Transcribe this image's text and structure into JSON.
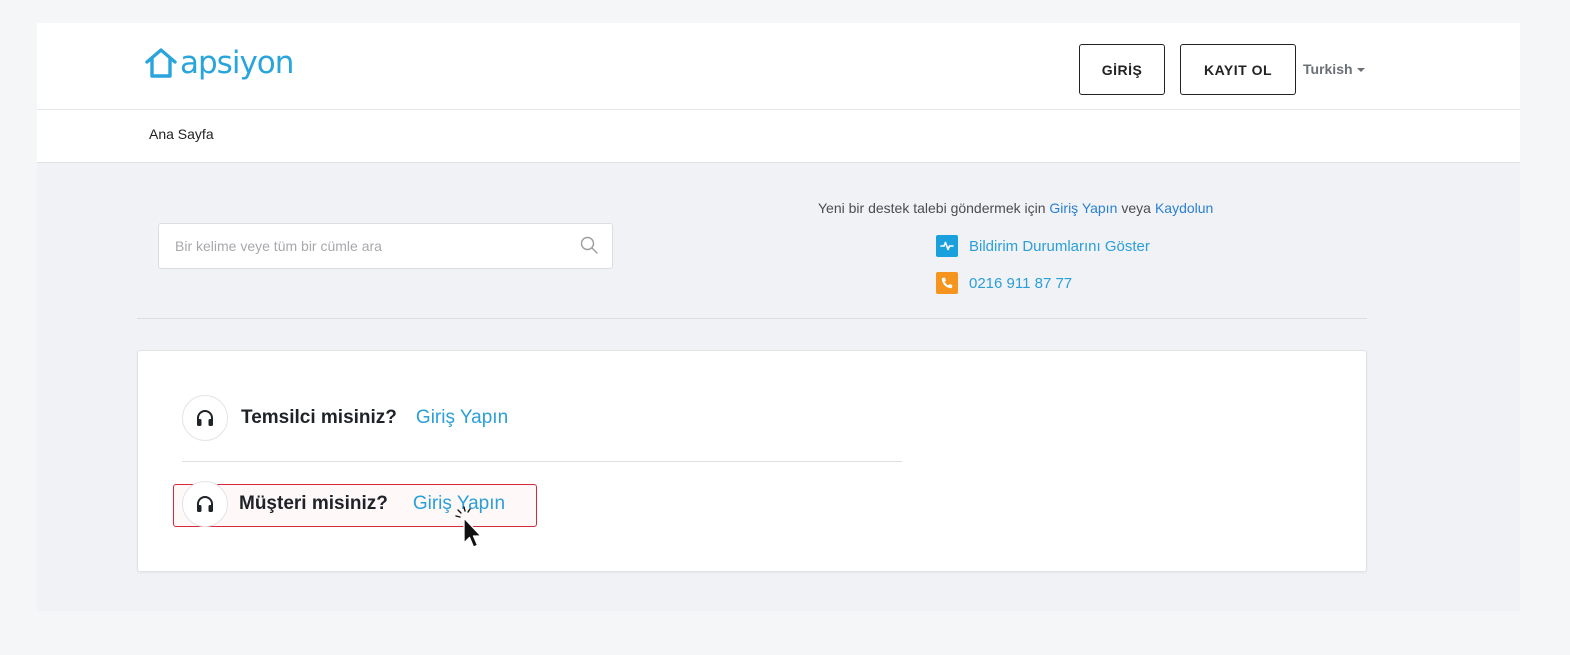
{
  "header": {
    "logo_text": "apsiyon",
    "login_label": "GİRİŞ",
    "register_label": "KAYIT OL",
    "language": "Turkish"
  },
  "breadcrumb": {
    "home": "Ana Sayfa"
  },
  "search": {
    "placeholder": "Bir kelime veye tüm bir cümle ara",
    "value": ""
  },
  "support": {
    "prefix": "Yeni bir destek talebi göndermek için",
    "login_link": "Giriş Yapın",
    "middle": "veya",
    "register_link": "Kaydolun",
    "status_link": "Bildirim Durumlarını Göster",
    "phone": "0216 911 87 77"
  },
  "login_options": [
    {
      "question": "Temsilci misiniz?",
      "link": "Giriş Yapın"
    },
    {
      "question": "Müşteri misiniz?",
      "link": "Giriş Yapın"
    }
  ],
  "colors": {
    "brand": "#29a4dc",
    "link": "#2a9fd8",
    "status_icon_bg": "#1aa0dc",
    "phone_icon_bg": "#f5941e",
    "highlight": "#d8293a"
  },
  "icons": {
    "logo": "house-icon",
    "search": "search-icon",
    "status": "pulse-icon",
    "phone": "phone-icon",
    "login_option": "headset-icon"
  }
}
